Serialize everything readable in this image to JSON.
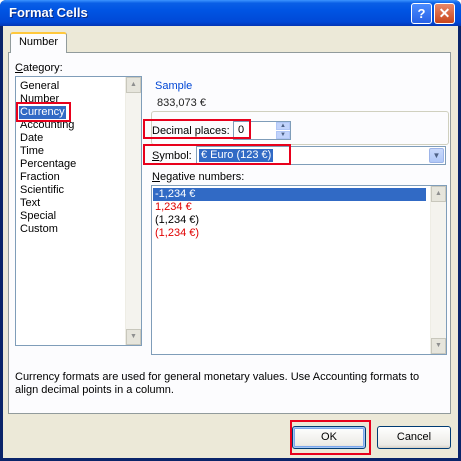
{
  "window": {
    "title": "Format Cells",
    "help_glyph": "?",
    "close_glyph": "✕"
  },
  "tabs": [
    {
      "label": "Number"
    }
  ],
  "category": {
    "label": "Category:",
    "items": [
      "General",
      "Number",
      "Currency",
      "Accounting",
      "Date",
      "Time",
      "Percentage",
      "Fraction",
      "Scientific",
      "Text",
      "Special",
      "Custom"
    ],
    "selected": "Currency"
  },
  "sample": {
    "label": "Sample",
    "value": "833,073 €"
  },
  "decimal_places": {
    "label": "Decimal places:",
    "value": "0"
  },
  "symbol": {
    "label": "Symbol:",
    "value": "€ Euro (123 €)"
  },
  "negative_numbers": {
    "label": "Negative numbers:",
    "items": [
      {
        "text": "-1,234 €",
        "red": false,
        "selected": true
      },
      {
        "text": "1,234 €",
        "red": true,
        "selected": false
      },
      {
        "text": "(1,234 €)",
        "red": false,
        "selected": false
      },
      {
        "text": "(1,234 €)",
        "red": true,
        "selected": false
      }
    ]
  },
  "description": "Currency formats are used for general monetary values.  Use Accounting formats to align decimal points in a column.",
  "buttons": {
    "ok": "OK",
    "cancel": "Cancel"
  },
  "colors": {
    "title_bar": "#0054e3",
    "dialog_bg": "#ece9d8",
    "selection": "#316ac5",
    "negative_red": "#e00000",
    "highlight_box": "#e8001c"
  }
}
